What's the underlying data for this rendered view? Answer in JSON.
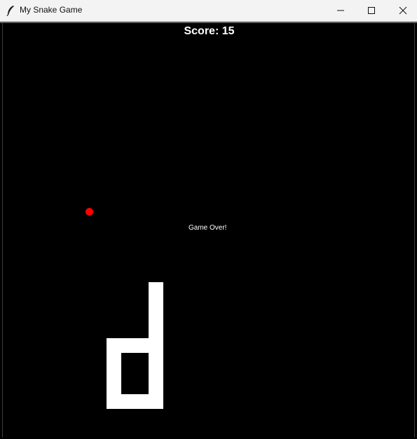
{
  "window": {
    "title": "My Snake Game",
    "icon": "feather-icon",
    "controls": [
      "minimize-icon",
      "maximize-icon",
      "close-icon"
    ]
  },
  "game": {
    "score_text": "Score: 15",
    "status_text": "Game Over!",
    "colors": {
      "background": "#000000",
      "snake": "#ffffff",
      "food": "#ff0000",
      "text": "#ffffff"
    }
  }
}
